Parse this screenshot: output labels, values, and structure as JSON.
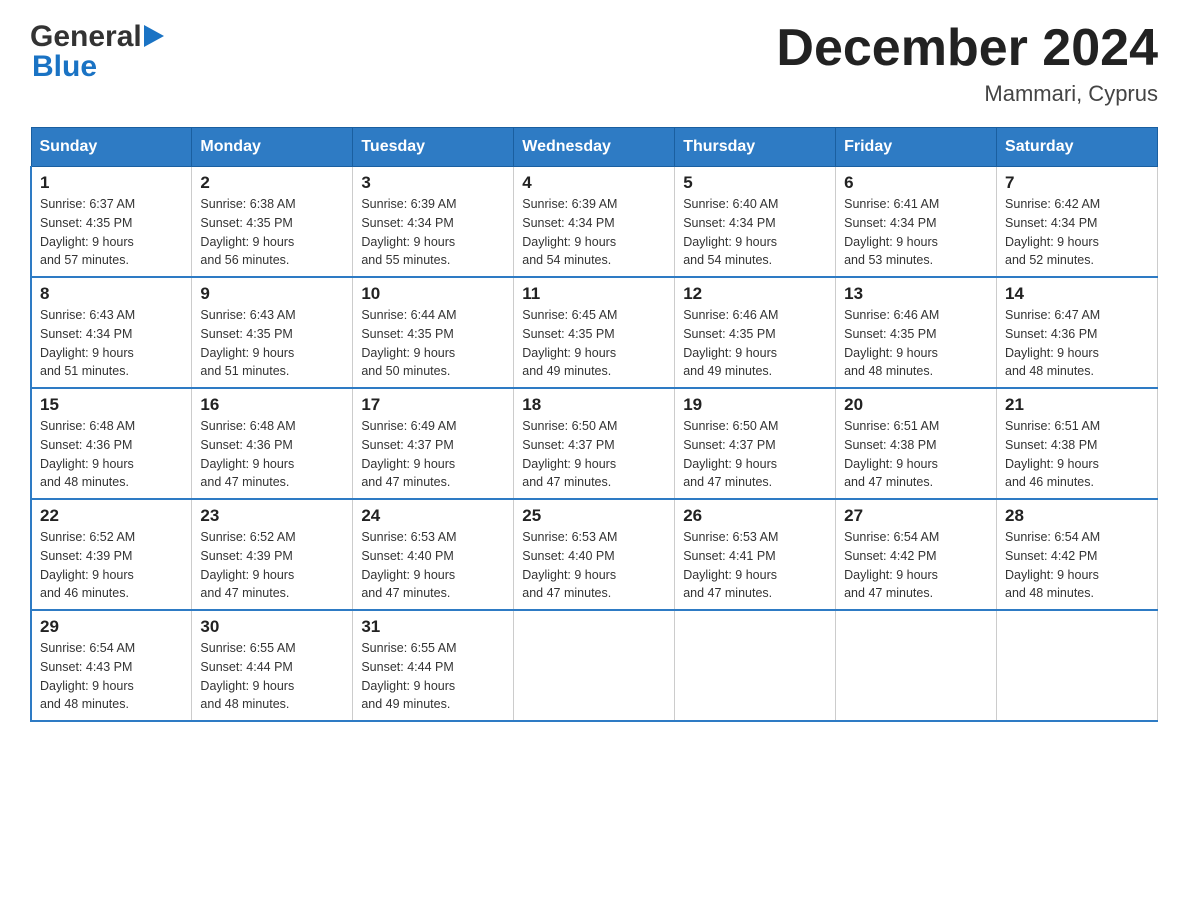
{
  "header": {
    "logo_general": "General",
    "logo_blue": "Blue",
    "title": "December 2024",
    "subtitle": "Mammari, Cyprus"
  },
  "days_of_week": [
    "Sunday",
    "Monday",
    "Tuesday",
    "Wednesday",
    "Thursday",
    "Friday",
    "Saturday"
  ],
  "weeks": [
    [
      {
        "day": "1",
        "sunrise": "Sunrise: 6:37 AM",
        "sunset": "Sunset: 4:35 PM",
        "daylight": "Daylight: 9 hours and 57 minutes."
      },
      {
        "day": "2",
        "sunrise": "Sunrise: 6:38 AM",
        "sunset": "Sunset: 4:35 PM",
        "daylight": "Daylight: 9 hours and 56 minutes."
      },
      {
        "day": "3",
        "sunrise": "Sunrise: 6:39 AM",
        "sunset": "Sunset: 4:34 PM",
        "daylight": "Daylight: 9 hours and 55 minutes."
      },
      {
        "day": "4",
        "sunrise": "Sunrise: 6:39 AM",
        "sunset": "Sunset: 4:34 PM",
        "daylight": "Daylight: 9 hours and 54 minutes."
      },
      {
        "day": "5",
        "sunrise": "Sunrise: 6:40 AM",
        "sunset": "Sunset: 4:34 PM",
        "daylight": "Daylight: 9 hours and 54 minutes."
      },
      {
        "day": "6",
        "sunrise": "Sunrise: 6:41 AM",
        "sunset": "Sunset: 4:34 PM",
        "daylight": "Daylight: 9 hours and 53 minutes."
      },
      {
        "day": "7",
        "sunrise": "Sunrise: 6:42 AM",
        "sunset": "Sunset: 4:34 PM",
        "daylight": "Daylight: 9 hours and 52 minutes."
      }
    ],
    [
      {
        "day": "8",
        "sunrise": "Sunrise: 6:43 AM",
        "sunset": "Sunset: 4:34 PM",
        "daylight": "Daylight: 9 hours and 51 minutes."
      },
      {
        "day": "9",
        "sunrise": "Sunrise: 6:43 AM",
        "sunset": "Sunset: 4:35 PM",
        "daylight": "Daylight: 9 hours and 51 minutes."
      },
      {
        "day": "10",
        "sunrise": "Sunrise: 6:44 AM",
        "sunset": "Sunset: 4:35 PM",
        "daylight": "Daylight: 9 hours and 50 minutes."
      },
      {
        "day": "11",
        "sunrise": "Sunrise: 6:45 AM",
        "sunset": "Sunset: 4:35 PM",
        "daylight": "Daylight: 9 hours and 49 minutes."
      },
      {
        "day": "12",
        "sunrise": "Sunrise: 6:46 AM",
        "sunset": "Sunset: 4:35 PM",
        "daylight": "Daylight: 9 hours and 49 minutes."
      },
      {
        "day": "13",
        "sunrise": "Sunrise: 6:46 AM",
        "sunset": "Sunset: 4:35 PM",
        "daylight": "Daylight: 9 hours and 48 minutes."
      },
      {
        "day": "14",
        "sunrise": "Sunrise: 6:47 AM",
        "sunset": "Sunset: 4:36 PM",
        "daylight": "Daylight: 9 hours and 48 minutes."
      }
    ],
    [
      {
        "day": "15",
        "sunrise": "Sunrise: 6:48 AM",
        "sunset": "Sunset: 4:36 PM",
        "daylight": "Daylight: 9 hours and 48 minutes."
      },
      {
        "day": "16",
        "sunrise": "Sunrise: 6:48 AM",
        "sunset": "Sunset: 4:36 PM",
        "daylight": "Daylight: 9 hours and 47 minutes."
      },
      {
        "day": "17",
        "sunrise": "Sunrise: 6:49 AM",
        "sunset": "Sunset: 4:37 PM",
        "daylight": "Daylight: 9 hours and 47 minutes."
      },
      {
        "day": "18",
        "sunrise": "Sunrise: 6:50 AM",
        "sunset": "Sunset: 4:37 PM",
        "daylight": "Daylight: 9 hours and 47 minutes."
      },
      {
        "day": "19",
        "sunrise": "Sunrise: 6:50 AM",
        "sunset": "Sunset: 4:37 PM",
        "daylight": "Daylight: 9 hours and 47 minutes."
      },
      {
        "day": "20",
        "sunrise": "Sunrise: 6:51 AM",
        "sunset": "Sunset: 4:38 PM",
        "daylight": "Daylight: 9 hours and 47 minutes."
      },
      {
        "day": "21",
        "sunrise": "Sunrise: 6:51 AM",
        "sunset": "Sunset: 4:38 PM",
        "daylight": "Daylight: 9 hours and 46 minutes."
      }
    ],
    [
      {
        "day": "22",
        "sunrise": "Sunrise: 6:52 AM",
        "sunset": "Sunset: 4:39 PM",
        "daylight": "Daylight: 9 hours and 46 minutes."
      },
      {
        "day": "23",
        "sunrise": "Sunrise: 6:52 AM",
        "sunset": "Sunset: 4:39 PM",
        "daylight": "Daylight: 9 hours and 47 minutes."
      },
      {
        "day": "24",
        "sunrise": "Sunrise: 6:53 AM",
        "sunset": "Sunset: 4:40 PM",
        "daylight": "Daylight: 9 hours and 47 minutes."
      },
      {
        "day": "25",
        "sunrise": "Sunrise: 6:53 AM",
        "sunset": "Sunset: 4:40 PM",
        "daylight": "Daylight: 9 hours and 47 minutes."
      },
      {
        "day": "26",
        "sunrise": "Sunrise: 6:53 AM",
        "sunset": "Sunset: 4:41 PM",
        "daylight": "Daylight: 9 hours and 47 minutes."
      },
      {
        "day": "27",
        "sunrise": "Sunrise: 6:54 AM",
        "sunset": "Sunset: 4:42 PM",
        "daylight": "Daylight: 9 hours and 47 minutes."
      },
      {
        "day": "28",
        "sunrise": "Sunrise: 6:54 AM",
        "sunset": "Sunset: 4:42 PM",
        "daylight": "Daylight: 9 hours and 48 minutes."
      }
    ],
    [
      {
        "day": "29",
        "sunrise": "Sunrise: 6:54 AM",
        "sunset": "Sunset: 4:43 PM",
        "daylight": "Daylight: 9 hours and 48 minutes."
      },
      {
        "day": "30",
        "sunrise": "Sunrise: 6:55 AM",
        "sunset": "Sunset: 4:44 PM",
        "daylight": "Daylight: 9 hours and 48 minutes."
      },
      {
        "day": "31",
        "sunrise": "Sunrise: 6:55 AM",
        "sunset": "Sunset: 4:44 PM",
        "daylight": "Daylight: 9 hours and 49 minutes."
      },
      null,
      null,
      null,
      null
    ]
  ]
}
